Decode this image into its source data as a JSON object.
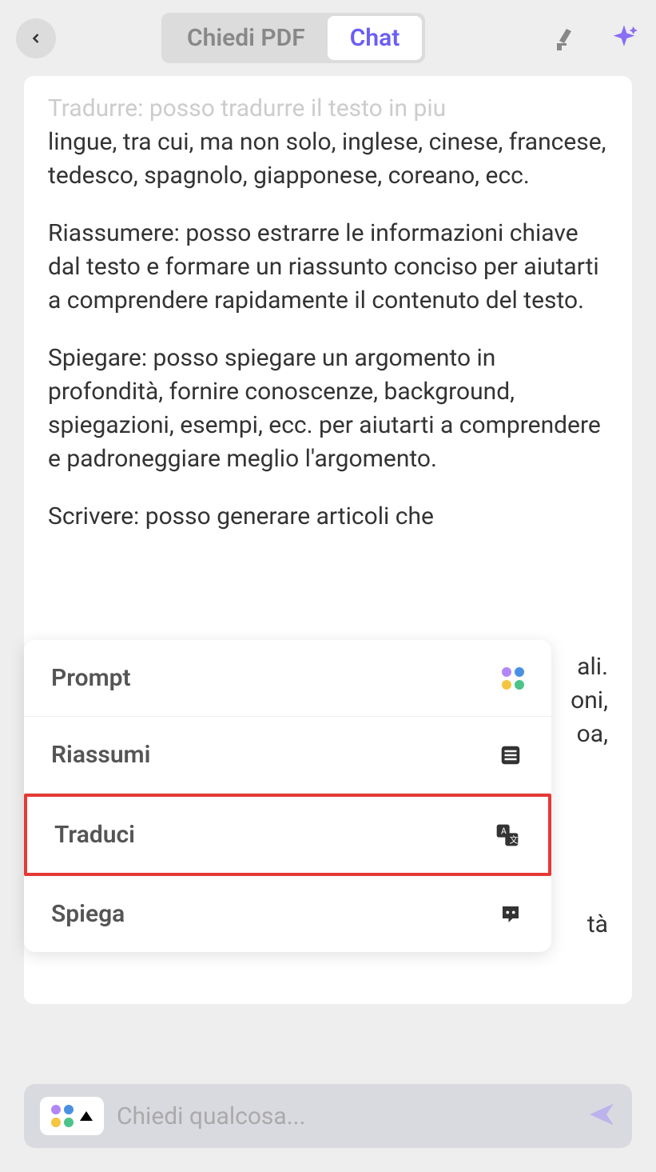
{
  "header": {
    "tab_pdf": "Chiedi PDF",
    "tab_chat": "Chat"
  },
  "chat": {
    "fade_line": "Tradurre: posso tradurre il testo in piu",
    "p1": "lingue, tra cui, ma non solo, inglese, cinese, francese, tedesco, spagnolo, giapponese, coreano, ecc.",
    "p2": "Riassumere: posso estrarre le informazioni chiave dal testo e formare un riassunto conciso per aiutarti a comprendere rapidamente il contenuto del testo.",
    "p3": "Spiegare: posso spiegare un argomento in profondità, fornire conoscenze, background, spiegazioni, esempi, ecc. per aiutarti a comprendere e padroneggiare meglio l'argomento.",
    "p4": "Scrivere: posso generare articoli che",
    "trail1": "ali.",
    "trail2": "oni,",
    "trail3": "oa,",
    "trail4": "tà"
  },
  "popup": {
    "prompt": "Prompt",
    "riassumi": "Riassumi",
    "traduci": "Traduci",
    "spiega": "Spiega"
  },
  "input": {
    "placeholder": "Chiedi qualcosa..."
  },
  "colors": {
    "accent": "#6b5ef5",
    "highlight": "#e53935"
  }
}
